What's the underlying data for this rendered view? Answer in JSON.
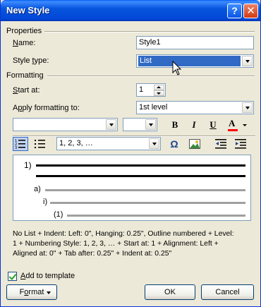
{
  "window": {
    "title": "New Style",
    "help_glyph": "?",
    "close_glyph": "✕"
  },
  "properties": {
    "group_label": "Properties",
    "name_label": "Name:",
    "name_value": "Style1",
    "style_type_label": "Style type:",
    "style_type_value": "List"
  },
  "formatting": {
    "group_label": "Formatting",
    "start_at_label": "Start at:",
    "start_at_value": "1",
    "apply_to_label": "Apply formatting to:",
    "apply_to_value": "1st level",
    "font_value": "",
    "size_value": "",
    "bold": "B",
    "italic": "I",
    "underline": "U",
    "font_color_glyph": "A",
    "numbering_style_value": "1, 2, 3, …",
    "symbol_glyph": "Ω"
  },
  "preview": {
    "level1": "1)",
    "level2": "a)",
    "level3": "i)",
    "level4": "(1)"
  },
  "description": {
    "line1": "No List + Indent: Left:  0\", Hanging:  0.25\", Outline numbered + Level:",
    "line2": "1 + Numbering Style: 1, 2, 3, … + Start at: 1 + Alignment: Left +",
    "line3": "Aligned at:  0\" + Tab after:  0.25\" + Indent at:  0.25\""
  },
  "add_to_template": {
    "label": "Add to template",
    "checked": true
  },
  "buttons": {
    "format": "Format",
    "ok": "OK",
    "cancel": "Cancel"
  },
  "colors": {
    "titlebar": "#0054e3",
    "selection": "#316ac5",
    "font_color_bar": "#ff0000"
  }
}
